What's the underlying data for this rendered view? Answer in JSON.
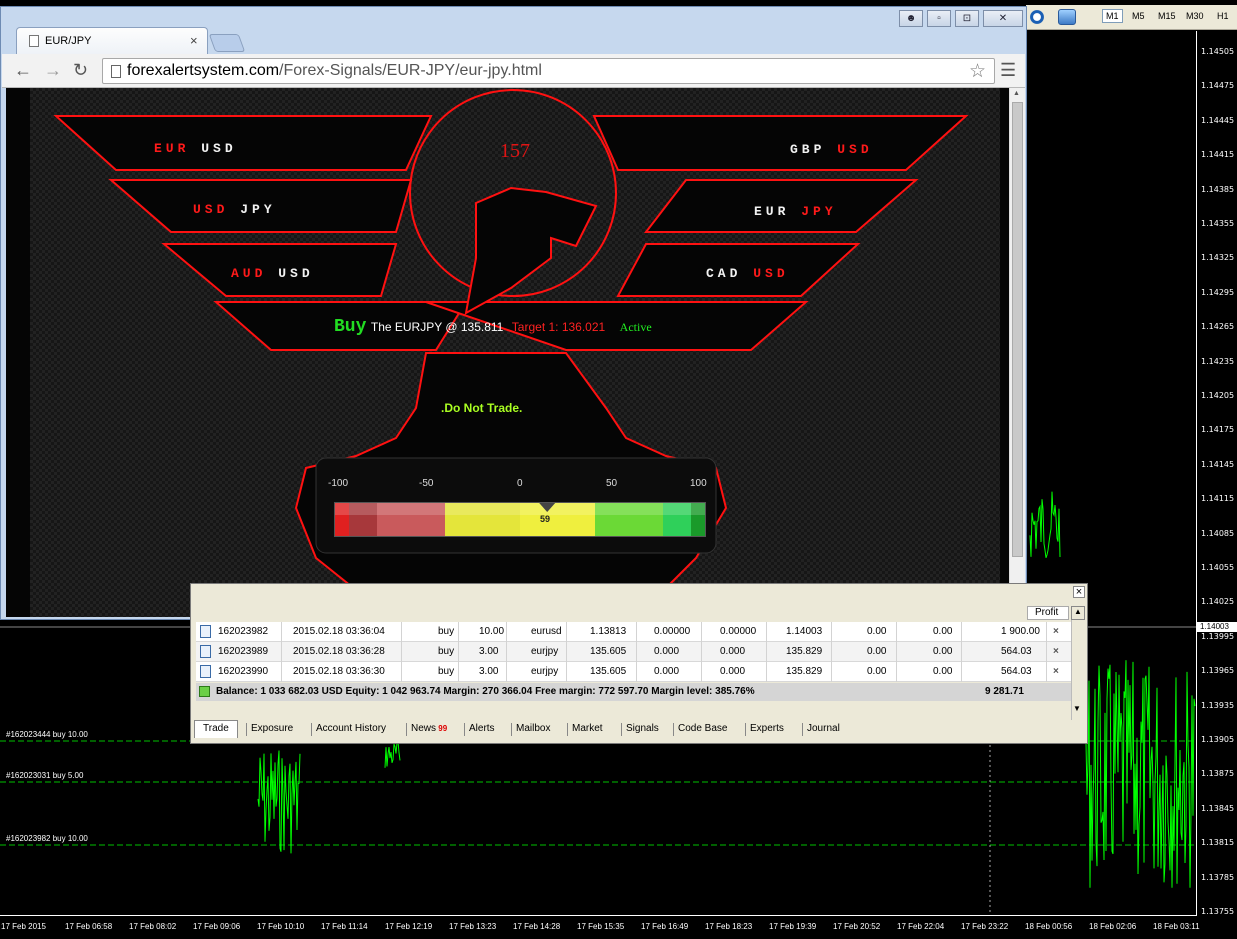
{
  "browser": {
    "tab_title": "EUR/JPY",
    "tab_close": "×",
    "url_domain": "forexalertsystem.com",
    "url_path": "/Forex-Signals/EUR-JPY/eur-jpy.html",
    "win_buttons": [
      "▫",
      "⊡",
      "✕"
    ]
  },
  "signals_page": {
    "left_pairs": [
      {
        "base": "EUR",
        "quote": "USD"
      },
      {
        "base": "USD",
        "quote": "JPY"
      },
      {
        "base": "AUD",
        "quote": "USD"
      }
    ],
    "right_pairs": [
      {
        "base": "GBP",
        "quote": "USD"
      },
      {
        "base": "EUR",
        "quote": "JPY"
      },
      {
        "base": "CAD",
        "quote": "USD"
      }
    ],
    "signal_count": "157",
    "signal_action": "Buy",
    "signal_pair_text": "The EURJPY @ 135.811",
    "signal_target": "Target 1: 136.021",
    "signal_status": "Active",
    "advice": ".Do Not Trade.",
    "gauge": {
      "ticks": [
        "-100",
        "-50",
        "0",
        "50",
        "100"
      ],
      "value": 59,
      "value_text": "59",
      "min": -100,
      "max": 100,
      "colors": {
        "red": "#c0393b",
        "yellow": "#e8e83a",
        "green": "#4fd12e"
      }
    }
  },
  "mt4": {
    "timeframes": [
      "M1",
      "M5",
      "M15",
      "M30",
      "H1"
    ],
    "selected_timeframe": "M1",
    "current_price": "1.14003",
    "price_labels": [
      "1.14505",
      "1.14475",
      "1.14445",
      "1.14415",
      "1.14385",
      "1.14355",
      "1.14325",
      "1.14295",
      "1.14265",
      "1.14235",
      "1.14205",
      "1.14175",
      "1.14145",
      "1.14115",
      "1.14085",
      "1.14055",
      "1.14025",
      "1.13995",
      "1.13965",
      "1.13935",
      "1.13905",
      "1.13875",
      "1.13845",
      "1.13815",
      "1.13785",
      "1.13755"
    ],
    "time_labels": [
      "17 Feb 2015",
      "17 Feb 06:58",
      "17 Feb 08:02",
      "17 Feb 09:06",
      "17 Feb 10:10",
      "17 Feb 11:14",
      "17 Feb 12:19",
      "17 Feb 13:23",
      "17 Feb 14:28",
      "17 Feb 15:35",
      "17 Feb 16:49",
      "17 Feb 18:23",
      "17 Feb 19:39",
      "17 Feb 20:52",
      "17 Feb 22:04",
      "17 Feb 23:22",
      "18 Feb 00:56",
      "18 Feb 02:06",
      "18 Feb 03:11"
    ],
    "order_lines": [
      "#162023444 buy 10.00",
      "#162023031 buy 5.00",
      "#162023982 buy 10.00"
    ],
    "colors": {
      "candles": "#00ff00",
      "order_line": "#00c000"
    }
  },
  "terminal": {
    "close": "×",
    "profit_header": "Profit",
    "orders": [
      {
        "ticket": "162023982",
        "time": "2015.02.18 03:36:04",
        "type": "buy",
        "size": "10.00",
        "symbol": "eurusd",
        "price": "1.13813",
        "sl": "0.00000",
        "tp": "0.00000",
        "cur": "1.14003",
        "comm": "0.00",
        "swap": "0.00",
        "profit": "1 900.00"
      },
      {
        "ticket": "162023989",
        "time": "2015.02.18 03:36:28",
        "type": "buy",
        "size": "3.00",
        "symbol": "eurjpy",
        "price": "135.605",
        "sl": "0.000",
        "tp": "0.000",
        "cur": "135.829",
        "comm": "0.00",
        "swap": "0.00",
        "profit": "564.03"
      },
      {
        "ticket": "162023990",
        "time": "2015.02.18 03:36:30",
        "type": "buy",
        "size": "3.00",
        "symbol": "eurjpy",
        "price": "135.605",
        "sl": "0.000",
        "tp": "0.000",
        "cur": "135.829",
        "comm": "0.00",
        "swap": "0.00",
        "profit": "564.03"
      }
    ],
    "balance_text": "Balance: 1 033 682.03 USD  Equity: 1 042 963.74  Margin: 270 366.04  Free margin: 772 597.70  Margin level: 385.76%",
    "total_profit": "9 281.71",
    "tabs": [
      "Trade",
      "Exposure",
      "Account History",
      "News",
      "Alerts",
      "Mailbox",
      "Market",
      "Signals",
      "Code Base",
      "Experts",
      "Journal"
    ],
    "news_count": "99",
    "selected_tab": "Trade"
  }
}
